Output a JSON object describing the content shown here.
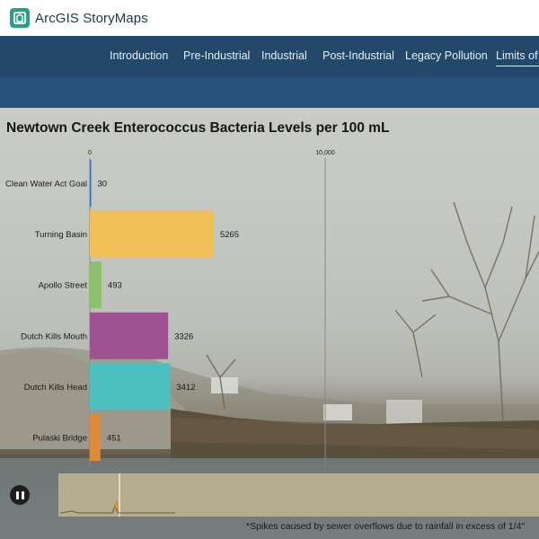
{
  "app": {
    "title": "ArcGIS StoryMaps"
  },
  "nav": {
    "tabs": [
      {
        "label": "Introduction"
      },
      {
        "label": "Pre-Industrial"
      },
      {
        "label": "Industrial"
      },
      {
        "label": "Post-Industrial"
      },
      {
        "label": "Legacy Pollution"
      },
      {
        "label": "Limits of l"
      }
    ],
    "active_index": 5
  },
  "chart_data": {
    "type": "bar",
    "orientation": "horizontal",
    "title": "Newtown Creek Enterococcus Bacteria Levels per 100 mL",
    "axis_ticks": [
      "0",
      "10,000"
    ],
    "xlim": [
      0,
      10000
    ],
    "categories": [
      "Clean Water Act Goal",
      "Turning Basin",
      "Apollo Street",
      "Dutch Kills Mouth",
      "Dutch Kills Head",
      "Pulaski Bridge"
    ],
    "values": [
      30,
      5265,
      493,
      3326,
      3412,
      451
    ],
    "value_labels": [
      "30",
      "5265",
      "493",
      "3326",
      "3412",
      "451"
    ],
    "colors": [
      "#3d6fb6",
      "#f0bf55",
      "#8cc06a",
      "#a05192",
      "#4ebfbf",
      "#e08a36"
    ],
    "grid": false
  },
  "timeline": {
    "playing": true
  },
  "footnote": "*Spikes caused by sewer overflows due to rainfall in excess of 1/4\""
}
